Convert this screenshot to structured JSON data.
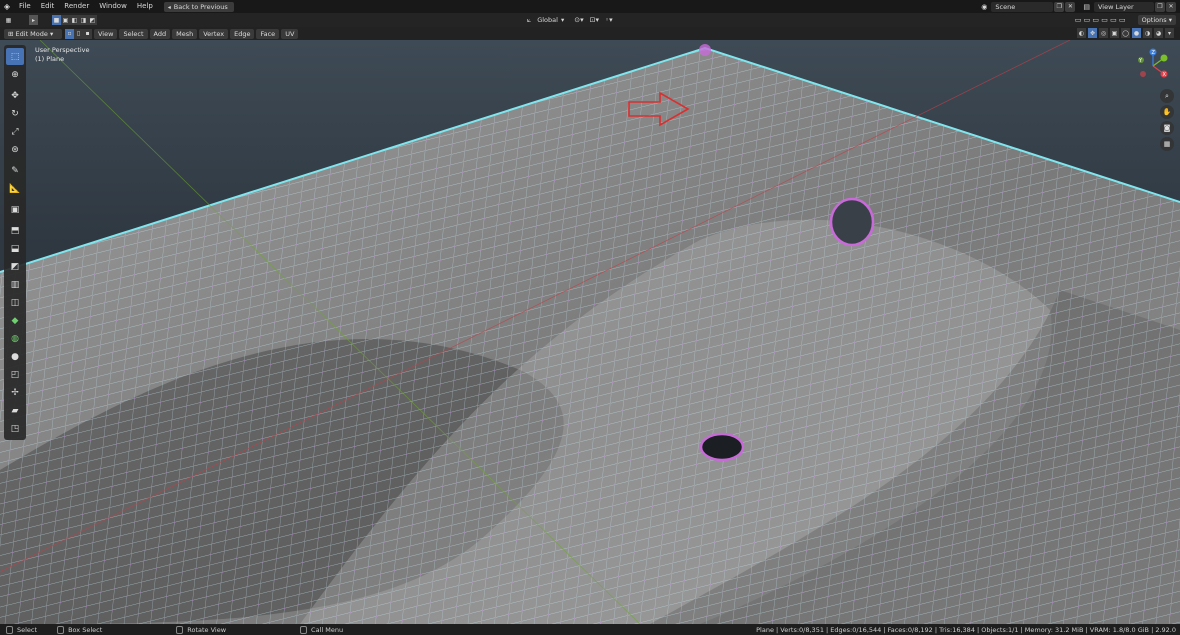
{
  "topbar": {
    "logo": "blender-logo",
    "menus": [
      "File",
      "Edit",
      "Render",
      "Window",
      "Help"
    ],
    "back_button": "Back to Previous",
    "scene": "Scene",
    "view_layer": "View Layer"
  },
  "header": {
    "mode": "Edit Mode",
    "menus": [
      "View",
      "Select",
      "Add",
      "Mesh",
      "Vertex",
      "Edge",
      "Face",
      "UV"
    ],
    "transform_orientation": "Global",
    "options": "Options"
  },
  "viewport": {
    "perspective_label": "User Perspective",
    "object_label": "(1) Plane",
    "gizmo_axes": [
      "X",
      "Y",
      "Z"
    ],
    "colors": {
      "x_axis": "#e0424b",
      "y_axis": "#7bbf2a",
      "z_axis": "#3c80e0",
      "wire": "#b9e6e6",
      "vertex": "#c86bd8",
      "annotation": "#d83030"
    }
  },
  "toolbar": {
    "tools": [
      "select-box-icon",
      "cursor-icon",
      "move-icon",
      "rotate-icon",
      "scale-icon",
      "transform-icon",
      "annotate-icon",
      "measure-icon",
      "add-cube-icon",
      "extrude-icon",
      "inset-icon",
      "bevel-icon",
      "loop-cut-icon",
      "knife-icon",
      "poly-build-icon",
      "spin-icon",
      "smooth-icon",
      "edge-slide-icon",
      "shrink-icon",
      "shear-icon",
      "rip-icon"
    ]
  },
  "statusbar": {
    "hint_select": "Select",
    "hint_box_select": "Box Select",
    "hint_rotate": "Rotate View",
    "hint_menu": "Call Menu",
    "stats": "Plane | Verts:0/8,351 | Edges:0/16,544 | Faces:0/8,192 | Tris:16,384 | Objects:1/1 | Memory: 31.2 MiB | VRAM: 1.8/8.0 GiB | 2.92.0"
  }
}
